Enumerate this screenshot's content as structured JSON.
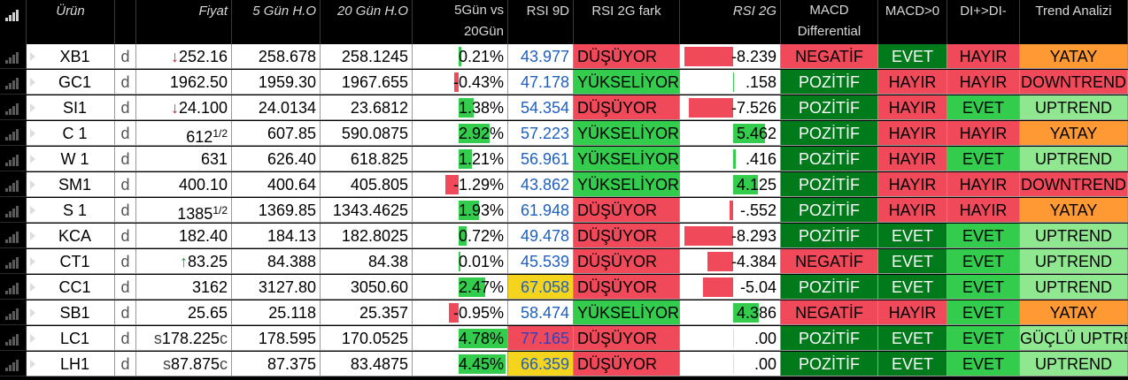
{
  "headers": [
    {
      "key": "signal",
      "label": "",
      "italic": false
    },
    {
      "key": "urun",
      "label": "Ürün",
      "italic": true
    },
    {
      "key": "d",
      "label": "",
      "italic": false
    },
    {
      "key": "fiyat",
      "label": "Fiyat",
      "italic": true
    },
    {
      "key": "g5",
      "label": "5 Gün H.O",
      "italic": true
    },
    {
      "key": "g20",
      "label": "20 Gün H.O",
      "italic": true
    },
    {
      "key": "vs",
      "label": "5Gün vs 20Gün",
      "italic": false
    },
    {
      "key": "rsi9",
      "label": "RSI 9D",
      "italic": false
    },
    {
      "key": "rsi2f",
      "label": "RSI 2G fark",
      "italic": false
    },
    {
      "key": "rsi2",
      "label": "RSI 2G",
      "italic": true
    },
    {
      "key": "macd",
      "label": "MACD Differential",
      "italic": false
    },
    {
      "key": "macd0",
      "label": "MACD>0",
      "italic": false
    },
    {
      "key": "di",
      "label": "DI+>DI-",
      "italic": false
    },
    {
      "key": "trend",
      "label": "Trend Analizi",
      "italic": false
    }
  ],
  "colors": {
    "bright_green": "#33cc4d",
    "dark_green": "#007a1a",
    "light_green": "#8fe88f",
    "red": "#f04a5a",
    "orange": "#ff9933",
    "yellow": "#f4d41c",
    "blue_text": "#1f5fbf"
  },
  "rows": [
    {
      "urun": "XB1",
      "d": "d",
      "arrow": "down",
      "prefix": "",
      "fiyat": "252.16",
      "frac": "",
      "suffix": "",
      "g5": "258.678",
      "g20": "258.1245",
      "vs": "0.21%",
      "vs_val": 0.21,
      "rsi9": "43.977",
      "rsi9_bg": "white",
      "rsi2f": "DÜŞÜYOR",
      "rsi2": "-8.239",
      "rsi2_val": -8.239,
      "macd": "NEGATİF",
      "macd0": "EVET",
      "di": "HAYIR",
      "trend": "YATAY"
    },
    {
      "urun": "GC1",
      "d": "d",
      "arrow": "",
      "prefix": "",
      "fiyat": "1962.50",
      "frac": "",
      "suffix": "",
      "g5": "1959.30",
      "g20": "1967.655",
      "vs": "-0.43%",
      "vs_val": -0.43,
      "rsi9": "47.178",
      "rsi9_bg": "white",
      "rsi2f": "YÜKSELİYOR",
      "rsi2": ".158",
      "rsi2_val": 0.158,
      "macd": "POZİTİF",
      "macd0": "HAYIR",
      "di": "HAYIR",
      "trend": "DOWNTREND"
    },
    {
      "urun": "SI1",
      "d": "d",
      "arrow": "down",
      "prefix": "",
      "fiyat": "24.100",
      "frac": "",
      "suffix": "",
      "g5": "24.0134",
      "g20": "23.6812",
      "vs": "1.38%",
      "vs_val": 1.38,
      "rsi9": "54.354",
      "rsi9_bg": "white",
      "rsi2f": "DÜŞÜYOR",
      "rsi2": "-7.526",
      "rsi2_val": -7.526,
      "macd": "POZİTİF",
      "macd0": "HAYIR",
      "di": "EVET",
      "trend": "UPTREND"
    },
    {
      "urun": "C 1",
      "d": "d",
      "arrow": "",
      "prefix": "",
      "fiyat": "612",
      "frac": "1/2",
      "suffix": "",
      "g5": "607.85",
      "g20": "590.0875",
      "vs": "2.92%",
      "vs_val": 2.92,
      "rsi9": "57.223",
      "rsi9_bg": "white",
      "rsi2f": "YÜKSELİYOR",
      "rsi2": "5.462",
      "rsi2_val": 5.462,
      "macd": "POZİTİF",
      "macd0": "HAYIR",
      "di": "HAYIR",
      "trend": "YATAY"
    },
    {
      "urun": "W 1",
      "d": "d",
      "arrow": "",
      "prefix": "",
      "fiyat": "631",
      "frac": "",
      "suffix": "",
      "g5": "626.40",
      "g20": "618.825",
      "vs": "1.21%",
      "vs_val": 1.21,
      "rsi9": "56.961",
      "rsi9_bg": "white",
      "rsi2f": "YÜKSELİYOR",
      "rsi2": ".416",
      "rsi2_val": 0.416,
      "macd": "POZİTİF",
      "macd0": "HAYIR",
      "di": "EVET",
      "trend": "UPTREND"
    },
    {
      "urun": "SM1",
      "d": "d",
      "arrow": "",
      "prefix": "",
      "fiyat": "400.10",
      "frac": "",
      "suffix": "",
      "g5": "400.64",
      "g20": "405.805",
      "vs": "-1.29%",
      "vs_val": -1.29,
      "rsi9": "43.862",
      "rsi9_bg": "white",
      "rsi2f": "YÜKSELİYOR",
      "rsi2": "4.125",
      "rsi2_val": 4.125,
      "macd": "POZİTİF",
      "macd0": "HAYIR",
      "di": "HAYIR",
      "trend": "DOWNTREND"
    },
    {
      "urun": "S 1",
      "d": "d",
      "arrow": "",
      "prefix": "",
      "fiyat": "1385",
      "frac": "1/2",
      "suffix": "",
      "g5": "1369.85",
      "g20": "1343.4625",
      "vs": "1.93%",
      "vs_val": 1.93,
      "rsi9": "61.948",
      "rsi9_bg": "white",
      "rsi2f": "DÜŞÜYOR",
      "rsi2": "-.552",
      "rsi2_val": -0.552,
      "macd": "POZİTİF",
      "macd0": "HAYIR",
      "di": "HAYIR",
      "trend": "YATAY"
    },
    {
      "urun": "KCA",
      "d": "d",
      "arrow": "",
      "prefix": "",
      "fiyat": "182.40",
      "frac": "",
      "suffix": "",
      "g5": "184.13",
      "g20": "182.8025",
      "vs": "0.72%",
      "vs_val": 0.72,
      "rsi9": "49.478",
      "rsi9_bg": "white",
      "rsi2f": "DÜŞÜYOR",
      "rsi2": "-8.293",
      "rsi2_val": -8.293,
      "macd": "POZİTİF",
      "macd0": "EVET",
      "di": "EVET",
      "trend": "UPTREND"
    },
    {
      "urun": "CT1",
      "d": "d",
      "arrow": "up",
      "prefix": "",
      "fiyat": "83.25",
      "frac": "",
      "suffix": "",
      "g5": "84.388",
      "g20": "84.38",
      "vs": "0.01%",
      "vs_val": 0.01,
      "rsi9": "45.539",
      "rsi9_bg": "white",
      "rsi2f": "DÜŞÜYOR",
      "rsi2": "-4.384",
      "rsi2_val": -4.384,
      "macd": "NEGATİF",
      "macd0": "EVET",
      "di": "EVET",
      "trend": "UPTREND"
    },
    {
      "urun": "CC1",
      "d": "d",
      "arrow": "",
      "prefix": "",
      "fiyat": "3162",
      "frac": "",
      "suffix": "",
      "g5": "3127.80",
      "g20": "3050.60",
      "vs": "2.47%",
      "vs_val": 2.47,
      "rsi9": "67.058",
      "rsi9_bg": "yellow",
      "rsi2f": "DÜŞÜYOR",
      "rsi2": "-5.04",
      "rsi2_val": -5.04,
      "macd": "POZİTİF",
      "macd0": "EVET",
      "di": "EVET",
      "trend": "UPTREND"
    },
    {
      "urun": "SB1",
      "d": "d",
      "arrow": "",
      "prefix": "",
      "fiyat": "25.65",
      "frac": "",
      "suffix": "",
      "g5": "25.118",
      "g20": "25.357",
      "vs": "-0.95%",
      "vs_val": -0.95,
      "rsi9": "58.474",
      "rsi9_bg": "white",
      "rsi2f": "YÜKSELİYOR",
      "rsi2": "4.386",
      "rsi2_val": 4.386,
      "macd": "NEGATİF",
      "macd0": "HAYIR",
      "di": "EVET",
      "trend": "YATAY"
    },
    {
      "urun": "LC1",
      "d": "d",
      "arrow": "",
      "prefix": "s",
      "fiyat": "178.225",
      "frac": "",
      "suffix": "c",
      "g5": "178.595",
      "g20": "170.0525",
      "vs": "4.78%",
      "vs_val": 4.78,
      "rsi9": "77.165",
      "rsi9_bg": "red",
      "rsi2f": "DÜŞÜYOR",
      "rsi2": ".00",
      "rsi2_val": 0.0,
      "macd": "POZİTİF",
      "macd0": "EVET",
      "di": "EVET",
      "trend": "GÜÇLÜ UPTREND"
    },
    {
      "urun": "LH1",
      "d": "d",
      "arrow": "",
      "prefix": "s",
      "fiyat": "87.875",
      "frac": "",
      "suffix": "c",
      "g5": "87.375",
      "g20": "83.4875",
      "vs": "4.45%",
      "vs_val": 4.45,
      "rsi9": "66.359",
      "rsi9_bg": "yellow",
      "rsi2f": "DÜŞÜYOR",
      "rsi2": ".00",
      "rsi2_val": 0.0,
      "macd": "POZİTİF",
      "macd0": "EVET",
      "di": "EVET",
      "trend": "UPTREND"
    }
  ]
}
